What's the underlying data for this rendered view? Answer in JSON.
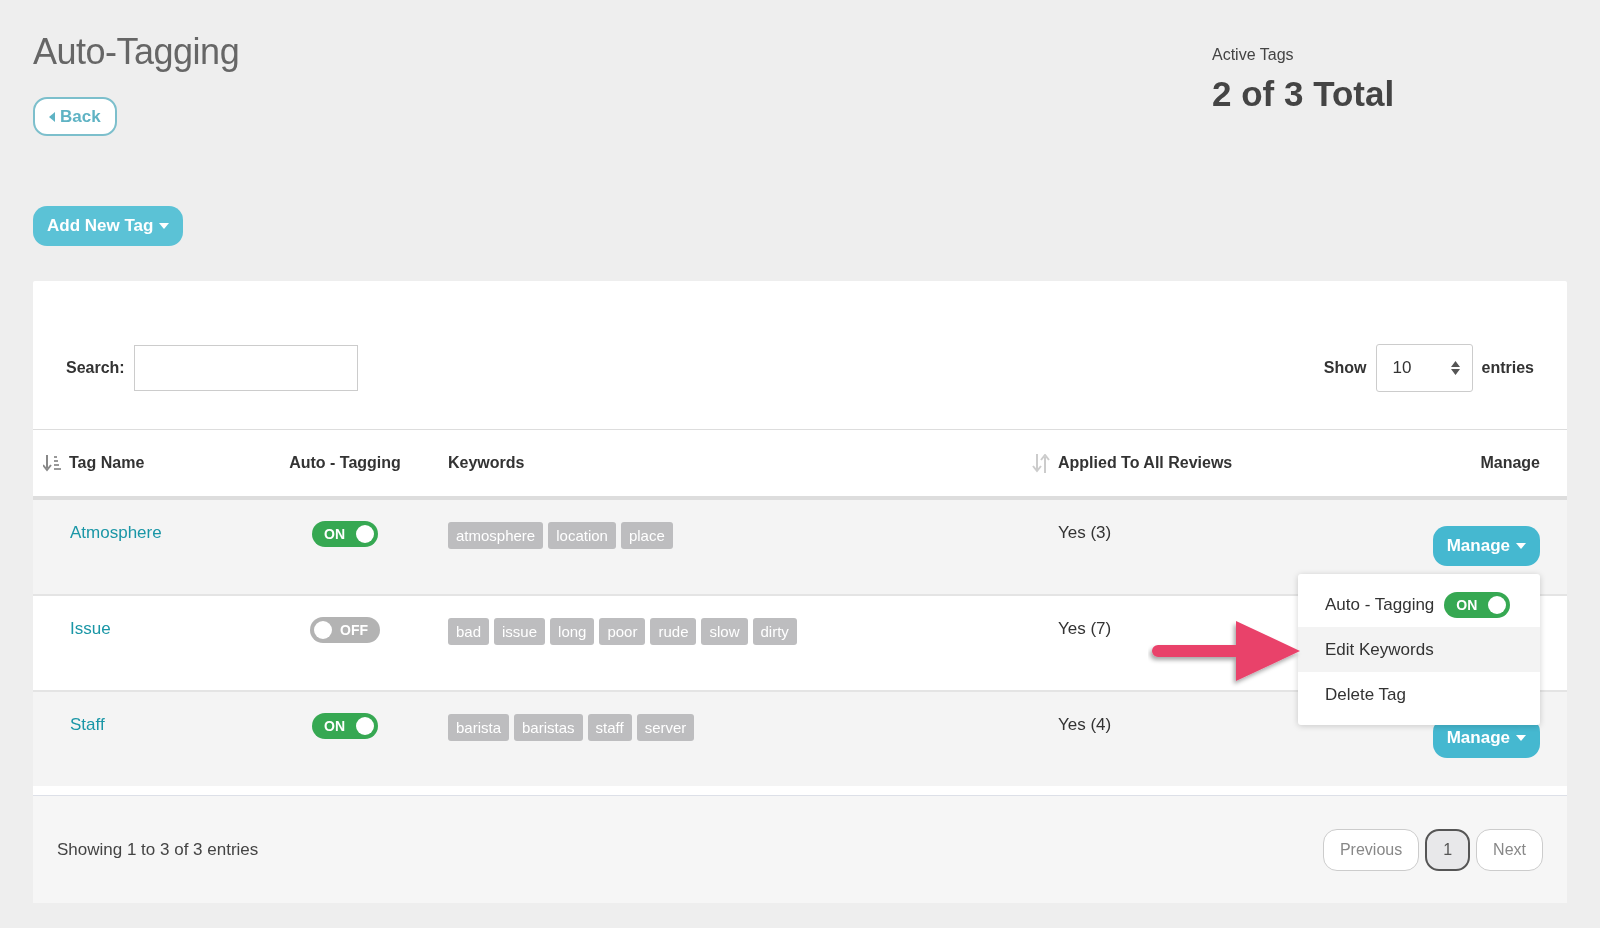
{
  "page": {
    "title": "Auto-Tagging",
    "back_button": "Back",
    "add_button": "Add New Tag"
  },
  "summary": {
    "label": "Active Tags",
    "value": "2 of 3 Total"
  },
  "table_controls": {
    "search_label": "Search:",
    "show_label": "Show",
    "page_size": "10",
    "entries_label": "entries"
  },
  "table": {
    "columns": [
      {
        "label": "Tag Name",
        "sortable": true,
        "sorted": true
      },
      {
        "label": "Auto - Tagging",
        "sortable": false
      },
      {
        "label": "Keywords",
        "sortable": false
      },
      {
        "label": "Applied To All Reviews",
        "sortable": true,
        "sorted": false
      },
      {
        "label": "Manage",
        "sortable": false
      }
    ],
    "rows": [
      {
        "name": "Atmosphere",
        "auto_tagging": {
          "on": true,
          "label": "ON"
        },
        "keywords": [
          "atmosphere",
          "location",
          "place"
        ],
        "applied": "Yes (3)",
        "manage": "Manage",
        "menu": {
          "items": [
            {
              "kind": "toggle",
              "label": "Auto - Tagging",
              "on": true,
              "toggle_label": "ON",
              "highlighted": false
            },
            {
              "kind": "link",
              "label": "Edit Keywords",
              "highlighted": true
            },
            {
              "kind": "link",
              "label": "Delete Tag",
              "highlighted": false
            }
          ]
        }
      },
      {
        "name": "Issue",
        "auto_tagging": {
          "on": false,
          "label": "OFF"
        },
        "keywords": [
          "bad",
          "issue",
          "long",
          "poor",
          "rude",
          "slow",
          "dirty"
        ],
        "applied": "Yes (7)"
      },
      {
        "name": "Staff",
        "auto_tagging": {
          "on": true,
          "label": "ON"
        },
        "keywords": [
          "barista",
          "baristas",
          "staff",
          "server"
        ],
        "applied": "Yes (4)",
        "manage": "Manage"
      }
    ]
  },
  "footer": {
    "info": "Showing 1 to 3 of 3 entries",
    "pagination": [
      {
        "label": "Previous",
        "selected": false
      },
      {
        "label": "1",
        "selected": true
      },
      {
        "label": "Next",
        "selected": false
      }
    ]
  }
}
